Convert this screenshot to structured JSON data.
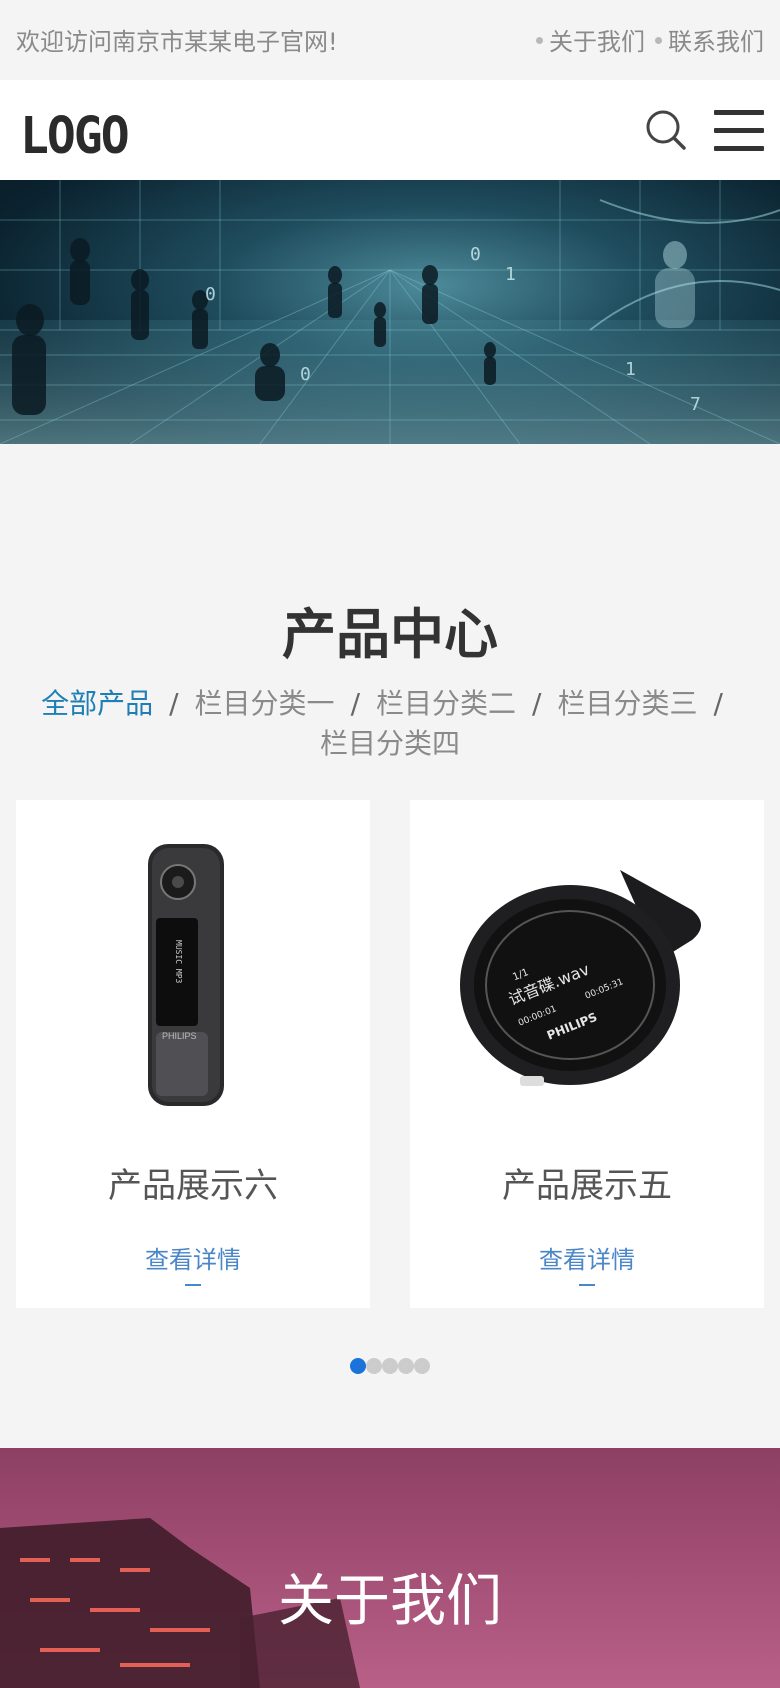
{
  "topbar": {
    "welcome": "欢迎访问南京市某某电子官网!",
    "links": [
      "关于我们",
      "联系我们"
    ]
  },
  "header": {
    "logo": "LOGO",
    "search_icon": "search-icon",
    "menu_icon": "hamburger-menu-icon"
  },
  "banner": {
    "image": "digital-city-banner"
  },
  "products": {
    "title": "产品中心",
    "categories": [
      "全部产品",
      "栏目分类一",
      "栏目分类二",
      "栏目分类三",
      "栏目分类四"
    ],
    "active_category": "全部产品",
    "separator": "/",
    "items": [
      {
        "name": "产品展示六",
        "more": "查看详情",
        "image": "philips-mp3-stick-player"
      },
      {
        "name": "产品展示五",
        "more": "查看详情",
        "image": "philips-round-mp3-player"
      }
    ],
    "pagination": {
      "total": 5,
      "current": 1
    }
  },
  "about": {
    "title": "关于我们"
  },
  "colors": {
    "accent": "#1f7fb5",
    "link": "#4a86c8",
    "dot_active": "#1a73d9",
    "about_bg": "#a04c72"
  }
}
